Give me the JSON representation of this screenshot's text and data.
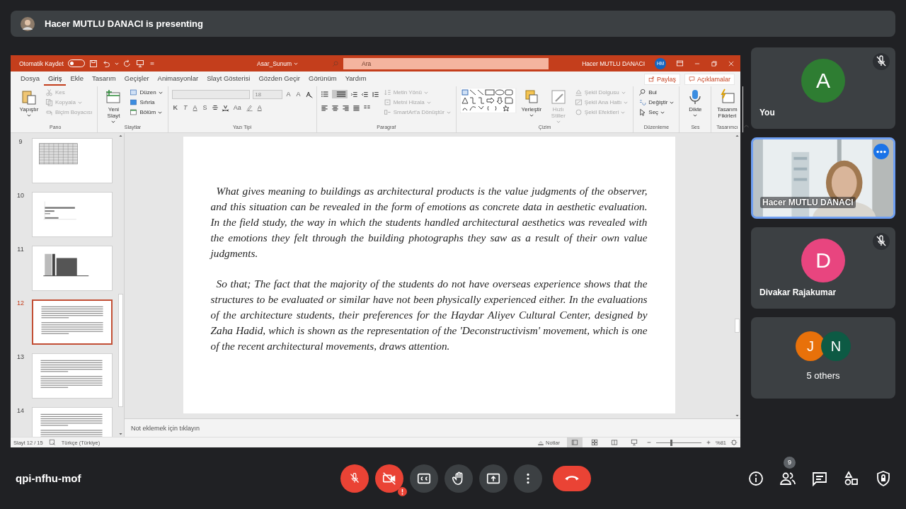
{
  "meeting": {
    "presenter_banner": "Hacer MUTLU DANACI is presenting",
    "meeting_code": "qpi-nfhu-mof",
    "controls": [
      {
        "kind": "mic",
        "on": false,
        "alert": false
      },
      {
        "kind": "camera",
        "on": false,
        "alert": true
      },
      {
        "kind": "captions",
        "alert": false
      },
      {
        "kind": "hand",
        "alert": false
      },
      {
        "kind": "present",
        "alert": false
      },
      {
        "kind": "more",
        "alert": false
      },
      {
        "kind": "end",
        "alert": false
      }
    ],
    "side_buttons": [
      {
        "kind": "info"
      },
      {
        "kind": "people",
        "badge": "9"
      },
      {
        "kind": "chat"
      },
      {
        "kind": "activities"
      },
      {
        "kind": "safety"
      }
    ],
    "participants": [
      {
        "kind": "avatar",
        "name": "You",
        "initial": "A",
        "color": "#2e7d32",
        "muted": true
      },
      {
        "kind": "video",
        "name": "Hacer MUTLU DANACI",
        "highlighted": true
      },
      {
        "kind": "avatar",
        "name": "Divakar Rajakumar",
        "initial": "D",
        "color": "#e8457f",
        "muted": true
      },
      {
        "kind": "group",
        "label": "5 others",
        "avatars": [
          {
            "initial": "J",
            "color": "#e8710a"
          },
          {
            "initial": "N",
            "color": "#0d5a44"
          }
        ]
      }
    ]
  },
  "powerpoint": {
    "title_bar": {
      "autosave_label": "Otomatik Kaydet",
      "autosave_on": false,
      "file_name": "Asar_Sunum",
      "search_placeholder": "Ara",
      "user_name": "Hacer MUTLU DANACI",
      "user_initials": "HM"
    },
    "tabs": [
      {
        "label": "Dosya",
        "selected": false
      },
      {
        "label": "Giriş",
        "selected": true
      },
      {
        "label": "Ekle",
        "selected": false
      },
      {
        "label": "Tasarım",
        "selected": false
      },
      {
        "label": "Geçişler",
        "selected": false
      },
      {
        "label": "Animasyonlar",
        "selected": false
      },
      {
        "label": "Slayt Gösterisi",
        "selected": false
      },
      {
        "label": "Gözden Geçir",
        "selected": false
      },
      {
        "label": "Görünüm",
        "selected": false
      },
      {
        "label": "Yardım",
        "selected": false
      }
    ],
    "share_button": "Paylaş",
    "comments_button": "Açıklamalar",
    "ribbon_groups": [
      {
        "kind": "standard",
        "label": "Pano",
        "items": [
          {
            "kind": "large",
            "label": "Yapıştır",
            "dropdown": true,
            "disabled": false
          },
          {
            "kind": "small",
            "label": "Kes",
            "dropdown": false,
            "disabled": true
          },
          {
            "kind": "small",
            "label": "Kopyala",
            "dropdown": true,
            "disabled": true
          },
          {
            "kind": "small",
            "label": "Biçim Boyacısı",
            "dropdown": false,
            "disabled": true
          }
        ]
      },
      {
        "kind": "standard",
        "label": "Slaytlar",
        "items": [
          {
            "kind": "large",
            "label": "Yeni Slayt",
            "dropdown": true,
            "disabled": false
          },
          {
            "kind": "small",
            "label": "Düzen",
            "dropdown": true,
            "disabled": false
          },
          {
            "kind": "small",
            "label": "Sıfırla",
            "dropdown": false,
            "disabled": false
          },
          {
            "kind": "small",
            "label": "Bölüm",
            "dropdown": true,
            "disabled": false
          }
        ]
      },
      {
        "kind": "font",
        "label": "Yazı Tipi",
        "font_size": "18",
        "size_buttons": [
          "A",
          "A"
        ],
        "format_buttons": [
          "K",
          "T",
          "A",
          "S"
        ],
        "case_button": "Aa",
        "color_button": "A"
      },
      {
        "kind": "paragraph",
        "label": "Paragraf",
        "items": [
          {
            "kind": "small",
            "label": "Metin Yönü",
            "dropdown": true,
            "disabled": true
          },
          {
            "kind": "small",
            "label": "Metni Hizala",
            "dropdown": true,
            "disabled": true
          },
          {
            "kind": "small",
            "label": "SmartArt'a Dönüştür",
            "dropdown": true,
            "disabled": true
          }
        ]
      },
      {
        "kind": "drawing",
        "label": "Çizim",
        "items": [
          {
            "kind": "large",
            "label": "Yerleştir",
            "dropdown": true,
            "disabled": false
          },
          {
            "kind": "large",
            "label": "Hızlı Stiller",
            "dropdown": true,
            "disabled": true
          },
          {
            "kind": "small",
            "label": "Şekil Dolgusu",
            "dropdown": true,
            "disabled": true
          },
          {
            "kind": "small",
            "label": "Şekil Ana Hattı",
            "dropdown": true,
            "disabled": true
          },
          {
            "kind": "small",
            "label": "Şekil Efektleri",
            "dropdown": true,
            "disabled": true
          }
        ]
      },
      {
        "kind": "standard",
        "label": "Düzenleme",
        "items": [
          {
            "kind": "small",
            "label": "Bul",
            "dropdown": false,
            "disabled": false
          },
          {
            "kind": "small",
            "label": "Değiştir",
            "dropdown": true,
            "disabled": false
          },
          {
            "kind": "small",
            "label": "Seç",
            "dropdown": true,
            "disabled": false
          }
        ]
      },
      {
        "kind": "standard",
        "label": "Ses",
        "items": [
          {
            "kind": "large",
            "label": "Dikte",
            "dropdown": true,
            "disabled": false
          }
        ]
      },
      {
        "kind": "standard",
        "label": "Tasarımcı",
        "items": [
          {
            "kind": "large",
            "label": "Tasarım Fikirleri",
            "dropdown": false,
            "disabled": false
          }
        ]
      }
    ],
    "slides": [
      {
        "number": "9",
        "kind": "table",
        "selected": false
      },
      {
        "number": "10",
        "kind": "chart",
        "selected": false
      },
      {
        "number": "11",
        "selected": false
      },
      {
        "number": "12",
        "kind": "text",
        "selected": true
      },
      {
        "number": "13",
        "kind": "text",
        "selected": false
      },
      {
        "number": "14",
        "kind": "text",
        "selected": false
      }
    ],
    "slide_paragraphs": [
      "What gives meaning to buildings as architectural products is the value judgments of the observer, and this situation can be revealed in the form of emotions as concrete data in aesthetic evaluation. In the field study, the way in which the students handled architectural aesthetics was revealed with the emotions they felt through the building photographs they saw as a result of their own value judgments.",
      "So that; The fact that the majority of the students do not have overseas experience shows that the structures to be evaluated or similar have not been physically experienced either. In the evaluations of the architecture students, their preferences for the Haydar Aliyev Cultural Center, designed by Zaha Hadid, which is shown as the representation of the 'Deconstructivism' movement, which is one of the recent architectural movements, draws attention."
    ],
    "notes_placeholder": "Not eklemek için tıklayın",
    "status_bar": {
      "slide_counter": "Slayt 12 / 15",
      "language": "Türkçe (Türkiye)",
      "notes_button": "Notlar",
      "views": [
        {
          "selected": true
        },
        {
          "selected": false
        },
        {
          "selected": false
        },
        {
          "selected": false
        }
      ],
      "zoom": {
        "level": 0.32
      },
      "zoom_text": "%81"
    }
  }
}
